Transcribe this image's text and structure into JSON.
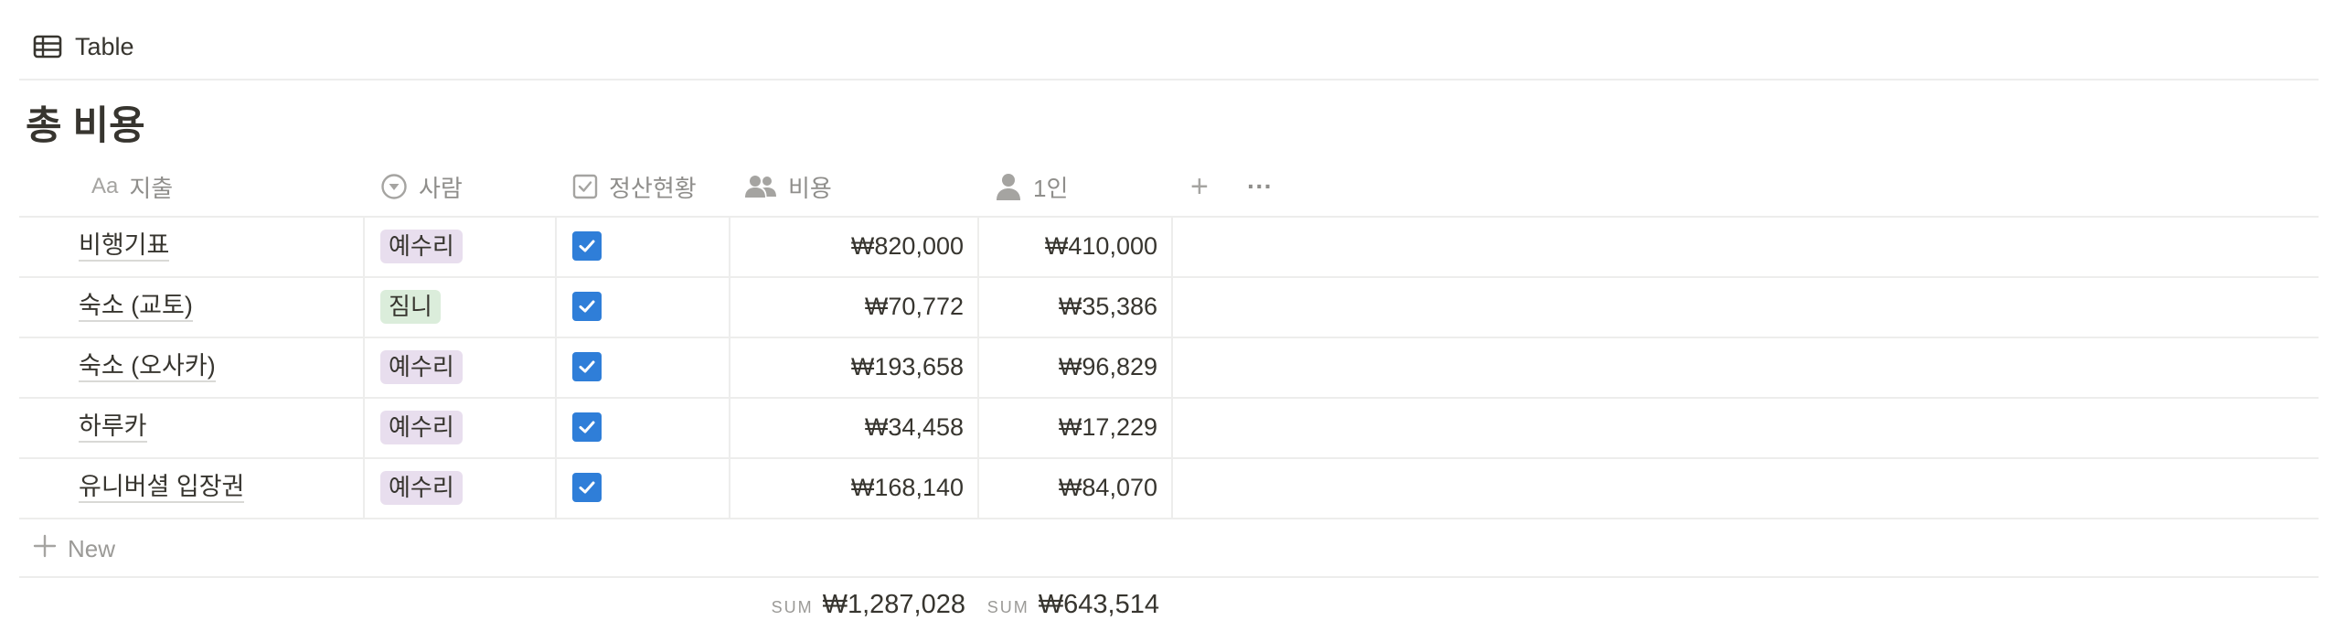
{
  "view_tab": {
    "label": "Table",
    "icon": "table-icon"
  },
  "title": "총 비용",
  "columns": [
    {
      "label": "지출",
      "icon": "text-aa-icon"
    },
    {
      "label": "사람",
      "icon": "select-icon"
    },
    {
      "label": "정산현황",
      "icon": "checkbox-icon"
    },
    {
      "label": "비용",
      "icon": "people-icon"
    },
    {
      "label": "1인",
      "icon": "person-icon"
    }
  ],
  "add_column_label": "+",
  "more_label": "···",
  "rows": [
    {
      "expense": "비행기표",
      "person": "예수리",
      "person_color": "#e8deee",
      "settled": true,
      "cost": "₩820,000",
      "per_person": "₩410,000"
    },
    {
      "expense": "숙소 (교토)",
      "person": "짐니",
      "person_color": "#dbeddb",
      "settled": true,
      "cost": "₩70,772",
      "per_person": "₩35,386"
    },
    {
      "expense": "숙소 (오사카)",
      "person": "예수리",
      "person_color": "#e8deee",
      "settled": true,
      "cost": "₩193,658",
      "per_person": "₩96,829"
    },
    {
      "expense": "하루카",
      "person": "예수리",
      "person_color": "#e8deee",
      "settled": true,
      "cost": "₩34,458",
      "per_person": "₩17,229"
    },
    {
      "expense": "유니버셜 입장권",
      "person": "예수리",
      "person_color": "#e8deee",
      "settled": true,
      "cost": "₩168,140",
      "per_person": "₩84,070"
    }
  ],
  "new_row_label": "New",
  "footer": {
    "cost_sum_label": "SUM",
    "cost_sum": "₩1,287,028",
    "per_person_sum_label": "SUM",
    "per_person_sum": "₩643,514"
  },
  "colors": {
    "checkbox": "#2f7ed8",
    "text": "#37352f",
    "muted": "#8f8e8b",
    "border": "#ededec"
  }
}
